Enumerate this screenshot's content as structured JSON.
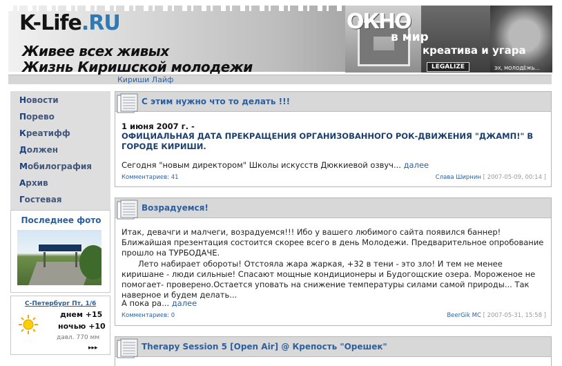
{
  "header": {
    "site_name_main": "K-Life",
    "site_name_domain": ".RU",
    "slogan_line1": "Живее всех живых",
    "slogan_line2": "Жизнь Киришской молодежи",
    "promo_word1": "ОКНО",
    "promo_word2": "в мир",
    "promo_word3": "креатива и угара",
    "promo_badge": "LEGALIZE",
    "promo_caption": "ЭХ, МОЛОДЁЖЬ..."
  },
  "breadcrumb": "Кириши Лайф",
  "nav": {
    "items": [
      {
        "first": "Н",
        "rest": "овости"
      },
      {
        "first": "П",
        "rest": "орево"
      },
      {
        "first": "К",
        "rest": "реатифф"
      },
      {
        "first": "Д",
        "rest": "олжен"
      },
      {
        "first": "М",
        "rest": "обилография"
      },
      {
        "first": "А",
        "rest": "рхив"
      },
      {
        "first": "Г",
        "rest": "остевая"
      }
    ]
  },
  "photo_box": {
    "title": "Последнее фото"
  },
  "weather": {
    "link": "С-Петербург  Пт, 1/6",
    "day": "днем +15",
    "night": "ночью +10",
    "pressure": "давл.   770 мм",
    "next": "▸▸▸",
    "icon": "sun-icon"
  },
  "posts": [
    {
      "title": "С этим нужно что то делать !!!",
      "date_line": "1 июня 2007 г. -",
      "headline": "ОФИЦИАЛЬНАЯ ДАТА ПРЕКРАЩЕНИЯ ОРГАНИЗОВАННОГО РОК-ДВИЖЕНИЯ \"ДЖАМП!\" В ГОРОДЕ КИРИШИ.",
      "excerpt": "Сегодня \"новым директором\" Школы искусств Дюккиевой озвуч...",
      "more": "далее",
      "comments": "Комментариев: 41",
      "author": "Слава Ширнин",
      "date": "[ 2007-05-09, 00:14 ]"
    },
    {
      "title": "Возрадуемся!",
      "para1": "Итак, девачги и малчеги, возрадуемся!!! Ибо у вашего любимого сайта появился баннер! Ближайшая презентация состоится скорее всего в день Молодежи. Предварительное опробование прошло на ТУРБОДАЧЕ.",
      "para2": "Лето набирает обороты! Отстояла жара жаркая, +32 в тени - это зло! И тем не менее киришане - люди сильные! Спасают мощные кондиционеры и Будогощские озера. Мороженое не помогает- проверено.Остается уповать на снижение температуры силами самой природы... Так наверное и будем делать...",
      "para3": "А пока ра...",
      "more": "далее",
      "comments": "Комментариев: 0",
      "author": "BeerGik MC",
      "date": "[ 2007-05-31, 15:58 ]"
    },
    {
      "title": "Therapy Session 5 [Open Air] @ Крепость \"Орешек\""
    }
  ],
  "colors": {
    "link": "#2c5f9f",
    "header_gray": "#d8d8d8",
    "nav_bg": "#dedede"
  }
}
